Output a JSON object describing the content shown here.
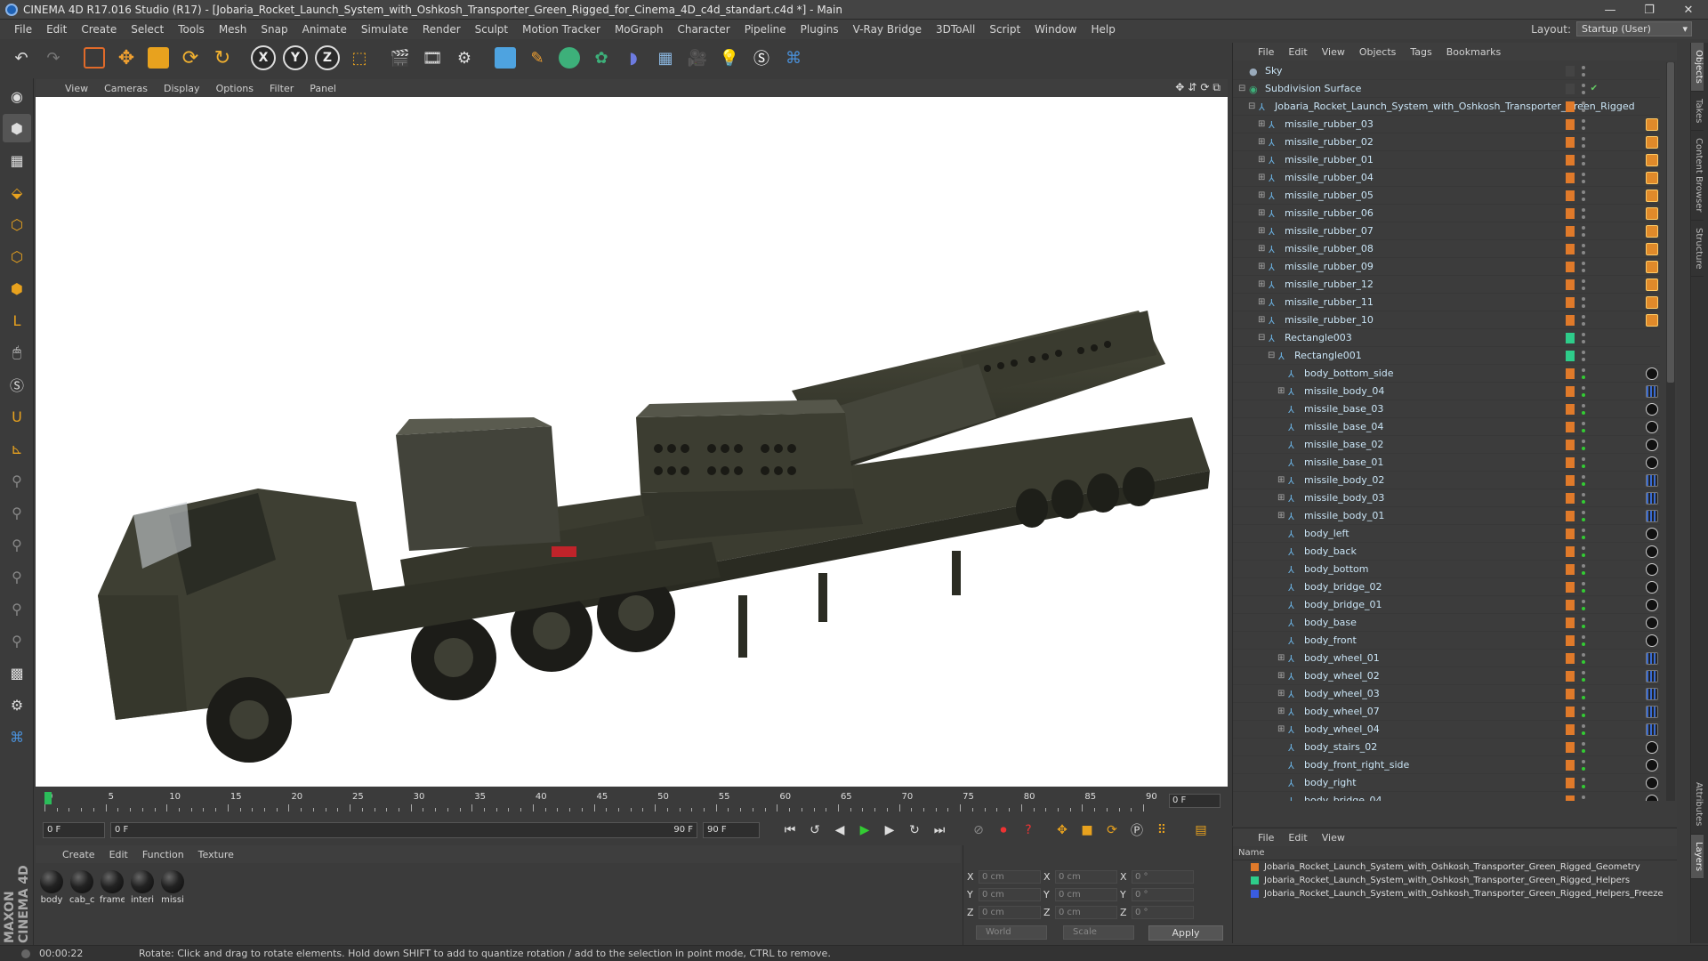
{
  "window": {
    "title": "CINEMA 4D R17.016 Studio (R17) - [Jobaria_Rocket_Launch_System_with_Oshkosh_Transporter_Green_Rigged_for_Cinema_4D_c4d_standart.c4d *] - Main",
    "controls": [
      "—",
      "❐",
      "✕"
    ]
  },
  "menu": [
    "File",
    "Edit",
    "Create",
    "Select",
    "Tools",
    "Mesh",
    "Snap",
    "Animate",
    "Simulate",
    "Render",
    "Sculpt",
    "Motion Tracker",
    "MoGraph",
    "Character",
    "Pipeline",
    "Plugins",
    "V-Ray Bridge",
    "3DToAll",
    "Script",
    "Window",
    "Help"
  ],
  "layout": {
    "label": "Layout:",
    "value": "Startup (User)"
  },
  "toolbar": {
    "x": "X",
    "y": "Y",
    "z": "Z"
  },
  "viewport": {
    "menu": [
      "View",
      "Cameras",
      "Display",
      "Options",
      "Filter",
      "Panel"
    ],
    "icons": [
      "✥",
      "⇵",
      "⟳",
      "⧉"
    ]
  },
  "timeline": {
    "labels": [
      "0",
      "5",
      "10",
      "15",
      "20",
      "25",
      "30",
      "35",
      "40",
      "45",
      "50",
      "55",
      "60",
      "65",
      "70",
      "75",
      "80",
      "85",
      "90"
    ],
    "frame_end": "0 F"
  },
  "transport": {
    "start": "0 F",
    "current": "0 F",
    "range_end": "90 F",
    "end": "90 F"
  },
  "materials": {
    "menu": [
      "Create",
      "Edit",
      "Function",
      "Texture"
    ],
    "items": [
      "body",
      "cab_c",
      "frame",
      "interi",
      "missi"
    ]
  },
  "coords": {
    "rows": [
      {
        "a1": "X",
        "v1": "0 cm",
        "a2": "X",
        "v2": "0 cm",
        "a3": "X",
        "v3": "0 °"
      },
      {
        "a1": "Y",
        "v1": "0 cm",
        "a2": "Y",
        "v2": "0 cm",
        "a3": "Y",
        "v3": "0 °"
      },
      {
        "a1": "Z",
        "v1": "0 cm",
        "a2": "Z",
        "v2": "0 cm",
        "a3": "Z",
        "v3": "0 °"
      }
    ],
    "world": "World",
    "scale": "Scale",
    "apply": "Apply"
  },
  "objects": {
    "menu": [
      "File",
      "Edit",
      "View",
      "Objects",
      "Tags",
      "Bookmarks"
    ],
    "rows": [
      {
        "label": "Sky",
        "indent": 0,
        "exp": "",
        "tag": "none",
        "color": "#444"
      },
      {
        "label": "Subdivision Surface",
        "indent": 0,
        "exp": "⊟",
        "tag": "none",
        "color": "#444"
      },
      {
        "label": "Jobaria_Rocket_Launch_System_with_Oshkosh_Transporter_Green_Rigged",
        "indent": 1,
        "exp": "⊟",
        "tag": "none",
        "color": "#e07a2a"
      },
      {
        "label": "missile_rubber_03",
        "indent": 2,
        "exp": "⊞",
        "tag": "rig",
        "color": "#e07a2a"
      },
      {
        "label": "missile_rubber_02",
        "indent": 2,
        "exp": "⊞",
        "tag": "rig",
        "color": "#e07a2a"
      },
      {
        "label": "missile_rubber_01",
        "indent": 2,
        "exp": "⊞",
        "tag": "rig",
        "color": "#e07a2a"
      },
      {
        "label": "missile_rubber_04",
        "indent": 2,
        "exp": "⊞",
        "tag": "rig",
        "color": "#e07a2a"
      },
      {
        "label": "missile_rubber_05",
        "indent": 2,
        "exp": "⊞",
        "tag": "rig",
        "color": "#e07a2a"
      },
      {
        "label": "missile_rubber_06",
        "indent": 2,
        "exp": "⊞",
        "tag": "rig",
        "color": "#e07a2a"
      },
      {
        "label": "missile_rubber_07",
        "indent": 2,
        "exp": "⊞",
        "tag": "rig",
        "color": "#e07a2a"
      },
      {
        "label": "missile_rubber_08",
        "indent": 2,
        "exp": "⊞",
        "tag": "rig",
        "color": "#e07a2a"
      },
      {
        "label": "missile_rubber_09",
        "indent": 2,
        "exp": "⊞",
        "tag": "rig",
        "color": "#e07a2a"
      },
      {
        "label": "missile_rubber_12",
        "indent": 2,
        "exp": "⊞",
        "tag": "rig",
        "color": "#e07a2a"
      },
      {
        "label": "missile_rubber_11",
        "indent": 2,
        "exp": "⊞",
        "tag": "rig",
        "color": "#e07a2a"
      },
      {
        "label": "missile_rubber_10",
        "indent": 2,
        "exp": "⊞",
        "tag": "rig",
        "color": "#e07a2a"
      },
      {
        "label": "Rectangle003",
        "indent": 2,
        "exp": "⊟",
        "tag": "none",
        "color": "#2ecc8a"
      },
      {
        "label": "Rectangle001",
        "indent": 3,
        "exp": "⊟",
        "tag": "none",
        "color": "#2ecc8a"
      },
      {
        "label": "body_bottom_side",
        "indent": 4,
        "exp": "",
        "tag": "mat",
        "color": "#e07a2a"
      },
      {
        "label": "missile_body_04",
        "indent": 4,
        "exp": "⊞",
        "tag": "dots",
        "color": "#e07a2a"
      },
      {
        "label": "missile_base_03",
        "indent": 4,
        "exp": "",
        "tag": "mat",
        "color": "#e07a2a"
      },
      {
        "label": "missile_base_04",
        "indent": 4,
        "exp": "",
        "tag": "mat",
        "color": "#e07a2a"
      },
      {
        "label": "missile_base_02",
        "indent": 4,
        "exp": "",
        "tag": "mat",
        "color": "#e07a2a"
      },
      {
        "label": "missile_base_01",
        "indent": 4,
        "exp": "",
        "tag": "mat",
        "color": "#e07a2a"
      },
      {
        "label": "missile_body_02",
        "indent": 4,
        "exp": "⊞",
        "tag": "dots",
        "color": "#e07a2a"
      },
      {
        "label": "missile_body_03",
        "indent": 4,
        "exp": "⊞",
        "tag": "dots",
        "color": "#e07a2a"
      },
      {
        "label": "missile_body_01",
        "indent": 4,
        "exp": "⊞",
        "tag": "dots",
        "color": "#e07a2a"
      },
      {
        "label": "body_left",
        "indent": 4,
        "exp": "",
        "tag": "mat",
        "color": "#e07a2a"
      },
      {
        "label": "body_back",
        "indent": 4,
        "exp": "",
        "tag": "mat",
        "color": "#e07a2a"
      },
      {
        "label": "body_bottom",
        "indent": 4,
        "exp": "",
        "tag": "mat",
        "color": "#e07a2a"
      },
      {
        "label": "body_bridge_02",
        "indent": 4,
        "exp": "",
        "tag": "mat",
        "color": "#e07a2a"
      },
      {
        "label": "body_bridge_01",
        "indent": 4,
        "exp": "",
        "tag": "mat",
        "color": "#e07a2a"
      },
      {
        "label": "body_base",
        "indent": 4,
        "exp": "",
        "tag": "mat",
        "color": "#e07a2a"
      },
      {
        "label": "body_front",
        "indent": 4,
        "exp": "",
        "tag": "mat",
        "color": "#e07a2a"
      },
      {
        "label": "body_wheel_01",
        "indent": 4,
        "exp": "⊞",
        "tag": "dots",
        "color": "#e07a2a"
      },
      {
        "label": "body_wheel_02",
        "indent": 4,
        "exp": "⊞",
        "tag": "dots",
        "color": "#e07a2a"
      },
      {
        "label": "body_wheel_03",
        "indent": 4,
        "exp": "⊞",
        "tag": "dots",
        "color": "#e07a2a"
      },
      {
        "label": "body_wheel_07",
        "indent": 4,
        "exp": "⊞",
        "tag": "dots",
        "color": "#e07a2a"
      },
      {
        "label": "body_wheel_04",
        "indent": 4,
        "exp": "⊞",
        "tag": "dots",
        "color": "#e07a2a"
      },
      {
        "label": "body_stairs_02",
        "indent": 4,
        "exp": "",
        "tag": "mat",
        "color": "#e07a2a"
      },
      {
        "label": "body_front_right_side",
        "indent": 4,
        "exp": "",
        "tag": "mat",
        "color": "#e07a2a"
      },
      {
        "label": "body_right",
        "indent": 4,
        "exp": "",
        "tag": "mat",
        "color": "#e07a2a"
      },
      {
        "label": "body_bridge_04",
        "indent": 4,
        "exp": "",
        "tag": "mat",
        "color": "#e07a2a"
      }
    ]
  },
  "layers": {
    "menu": [
      "File",
      "Edit",
      "View"
    ],
    "header": "Name",
    "rows": [
      {
        "label": "Jobaria_Rocket_Launch_System_with_Oshkosh_Transporter_Green_Rigged_Geometry",
        "color": "#e07a2a"
      },
      {
        "label": "Jobaria_Rocket_Launch_System_with_Oshkosh_Transporter_Green_Rigged_Helpers",
        "color": "#2ecc8a"
      },
      {
        "label": "Jobaria_Rocket_Launch_System_with_Oshkosh_Transporter_Green_Rigged_Helpers_Freeze",
        "color": "#3a5ce0"
      }
    ]
  },
  "right_tabs": [
    "Objects",
    "Takes",
    "Content Browser",
    "Structure",
    "Attributes",
    "Layers"
  ],
  "status": {
    "time": "00:00:22",
    "message": "Rotate: Click and drag to rotate elements. Hold down SHIFT to add to quantize rotation / add to the selection in point mode, CTRL to remove."
  },
  "maxon": "MAXON CINEMA 4D"
}
